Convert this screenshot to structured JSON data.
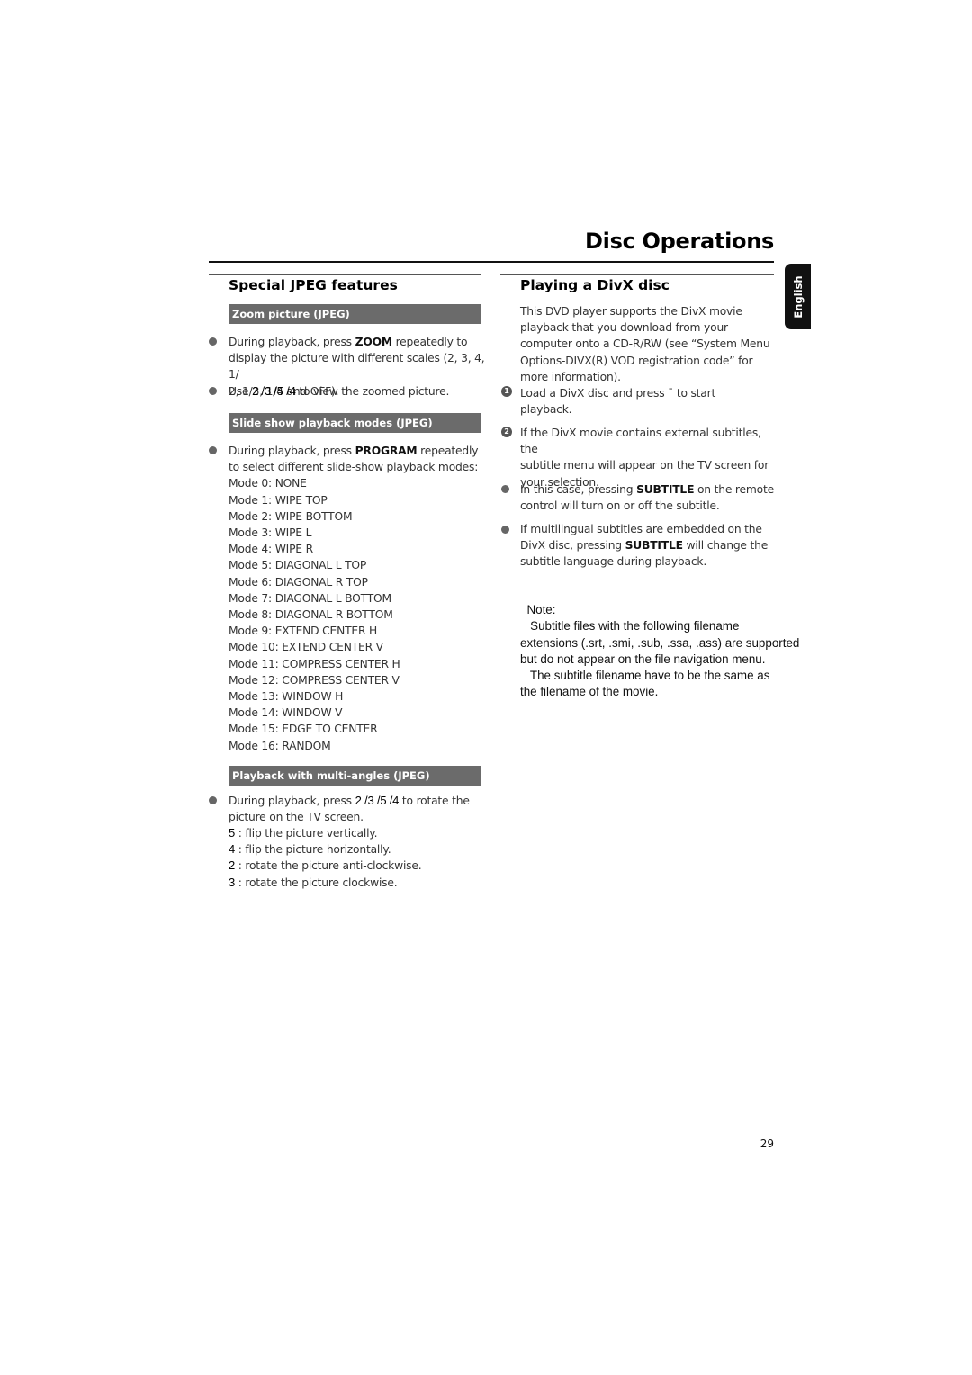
{
  "header": {
    "title": "Disc Operations",
    "language_tab": "English"
  },
  "left": {
    "heading": "Special JPEG features",
    "zoom": {
      "bar": "Zoom picture (JPEG)",
      "b1_pre": "During playback, press ",
      "b1_key": "ZOOM",
      "b1_post": " repeatedly to",
      "b1_l2": "display the picture with different scales (2, 3, 4, 1/",
      "b1_l3": "2, 1/3, 1/4 and OFF).",
      "b2_pre": "Use ",
      "b2_keys": "2 /3 /5 /4",
      "b2_post": "  to view the zoomed picture."
    },
    "slideshow": {
      "bar": "Slide show playback modes (JPEG)",
      "b1_pre": "During playback, press ",
      "b1_key": "PROGRAM",
      "b1_post": " repeatedly",
      "b1_l2": "to select different slide-show playback modes:",
      "modes": [
        "Mode 0: NONE",
        "Mode 1: WIPE TOP",
        "Mode 2: WIPE BOTTOM",
        "Mode 3: WIPE L",
        "Mode 4: WIPE R",
        "Mode 5: DIAGONAL L TOP",
        "Mode 6: DIAGONAL R TOP",
        "Mode 7: DIAGONAL L BOTTOM",
        "Mode 8: DIAGONAL R BOTTOM",
        "Mode 9: EXTEND CENTER H",
        "Mode 10: EXTEND CENTER V",
        "Mode 11: COMPRESS CENTER H",
        "Mode 12: COMPRESS CENTER V",
        "Mode 13: WINDOW H",
        "Mode 14: WINDOW V",
        "Mode 15: EDGE TO CENTER",
        "Mode 16:  RANDOM"
      ]
    },
    "multiangle": {
      "bar": "Playback with multi-angles (JPEG)",
      "b1_pre": "During playback, press ",
      "b1_keys": "2 /3 /5 /4",
      "b1_post": "  to rotate the",
      "b1_l2": "picture on the TV screen.",
      "items": [
        {
          "key": "5",
          "text": " : flip the picture vertically."
        },
        {
          "key": " 4",
          "text": " : flip the picture horizontally."
        },
        {
          "key": "2",
          "text": " :  rotate the picture anti-clockwise."
        },
        {
          "key": " 3",
          "text": " :  rotate the picture clockwise."
        }
      ]
    }
  },
  "right": {
    "heading": "Playing a DivX disc",
    "intro": [
      "This DVD player supports the DivX movie",
      "playback that you download from your",
      "computer onto a CD-R/RW (see “System Menu",
      "Options-DIVX(R) VOD registration code” for",
      "more information)."
    ],
    "step1_num": "1",
    "step1_l1": "Load a DivX disc and press   ˉ   to start",
    "step1_l2": "playback.",
    "step2_num": "2",
    "step2": [
      "If the DivX movie contains external subtitles, the",
      "subtitle menu will appear on the TV screen for",
      "your selection."
    ],
    "b1_pre": "In this case, pressing ",
    "b1_key": "SUBTITLE",
    "b1_post": " on the remote",
    "b1_l2": "control will turn on or off the subtitle.",
    "b2_l1": "If multilingual subtitles are embedded on the",
    "b2_pre": "DivX disc, pressing ",
    "b2_key": "SUBTITLE",
    "b2_post": " will change the",
    "b2_l3": "subtitle language during playback.",
    "note": {
      "label": "Note:",
      "lines": [
        "   Subtitle files with the following filename",
        "extensions (.srt, .smi, .sub, .ssa, .ass) are supported",
        "but do not appear on the file navigation menu.",
        "   The subtitle filename have to be the same as",
        "the filename of the movie."
      ]
    }
  },
  "footer": {
    "page_number": "29"
  }
}
